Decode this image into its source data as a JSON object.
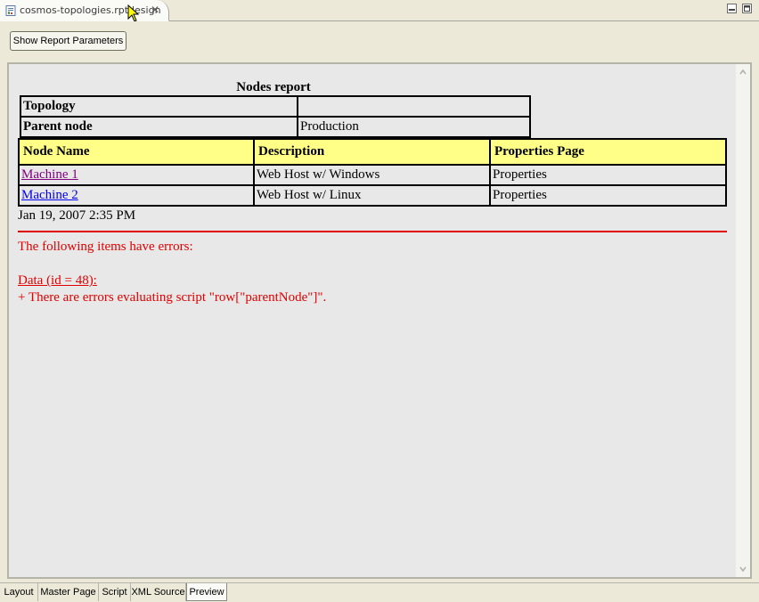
{
  "editor_tab": {
    "title": "cosmos-topologies.rptdesign",
    "close_icon": "close-icon",
    "file_icon": "report-file-icon"
  },
  "toolbar": {
    "show_params_label": "Show Report Parameters"
  },
  "report": {
    "title": "Nodes report",
    "params": [
      {
        "label": "Topology",
        "value": ""
      },
      {
        "label": "Parent node",
        "value": "Production"
      }
    ],
    "table": {
      "headers": [
        "Node Name",
        "Description",
        "Properties Page"
      ],
      "rows": [
        {
          "name": "Machine 1",
          "description": "Web Host w/ Windows",
          "properties": "Properties",
          "visited": true
        },
        {
          "name": "Machine 2",
          "description": "Web Host w/ Linux",
          "properties": "Properties",
          "visited": false
        }
      ],
      "header_color": "#ffff88"
    },
    "date": "Jan 19, 2007 2:35 PM",
    "errors": {
      "heading": "The following items have errors:",
      "item": "Data (id = 48):",
      "detail": "+ There are errors evaluating script \"row[\"parentNode\"]\".",
      "color": "#e00000"
    }
  },
  "page_tabs": [
    {
      "label": "Layout",
      "active": false
    },
    {
      "label": "Master Page",
      "active": false
    },
    {
      "label": "Script",
      "active": false
    },
    {
      "label": "XML Source",
      "active": false
    },
    {
      "label": "Preview",
      "active": true
    }
  ]
}
